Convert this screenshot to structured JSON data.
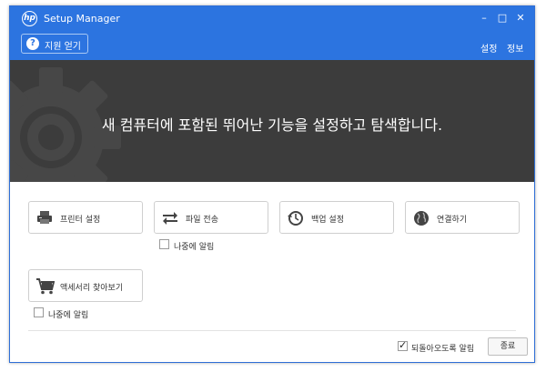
{
  "window": {
    "title": "Setup Manager",
    "logo_text": "hp",
    "controls": {
      "minimize": "–",
      "maximize": "□",
      "close": "✕"
    }
  },
  "toolbar": {
    "support_label": "지원 얻기",
    "settings_label": "설정",
    "info_label": "정보"
  },
  "hero": {
    "headline": "새 컴퓨터에 포함된 뛰어난 기능을 설정하고 탐색합니다."
  },
  "tiles": [
    {
      "label": "프린터 설정",
      "icon": "printer-icon"
    },
    {
      "label": "파일 전송",
      "icon": "transfer-arrows-icon",
      "checkbox_label": "나중에 알림",
      "checked": false
    },
    {
      "label": "백업 설정",
      "icon": "backup-clock-icon"
    },
    {
      "label": "연결하기",
      "icon": "globe-icon"
    },
    {
      "label": "액세서리 찾아보기",
      "icon": "cart-icon",
      "checkbox_label": "나중에 알림",
      "checked": false
    }
  ],
  "footer": {
    "remind_label": "되돌아오도록 알림",
    "remind_checked": true,
    "close_label": "종료"
  },
  "colors": {
    "accent": "#2c74e0",
    "hero_background": "#3c3c3c"
  }
}
